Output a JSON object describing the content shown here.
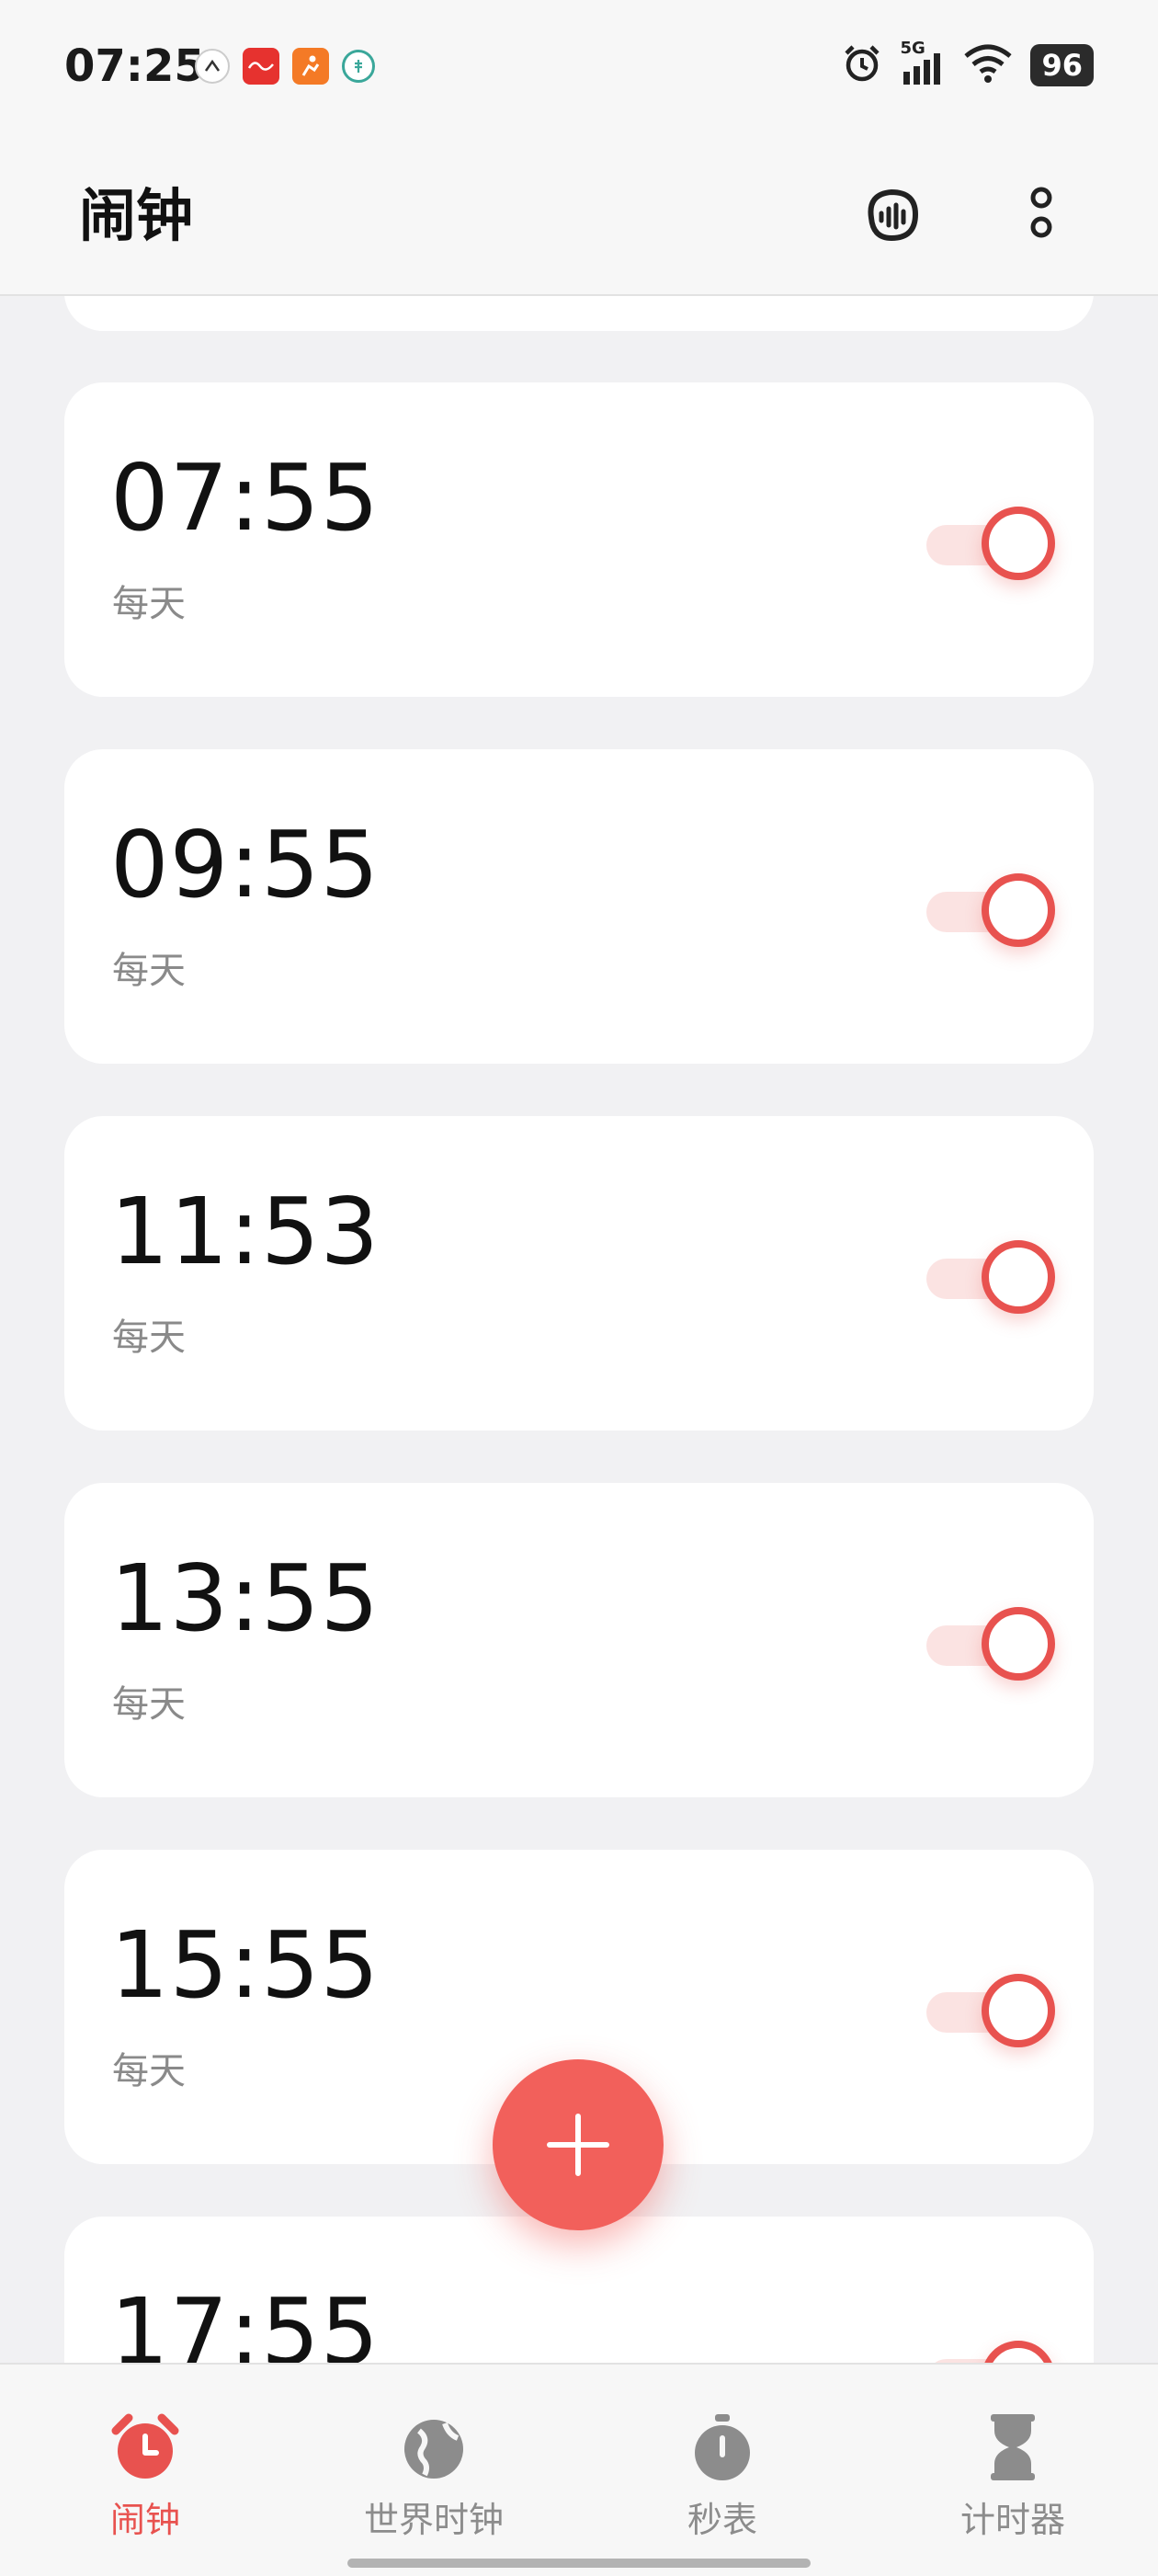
{
  "status_bar": {
    "time": "07:25",
    "battery": "96",
    "network": "5G"
  },
  "header": {
    "title": "闹钟"
  },
  "alarms": [
    {
      "time": "07:55",
      "repeat": "每天",
      "enabled": true
    },
    {
      "time": "09:55",
      "repeat": "每天",
      "enabled": true
    },
    {
      "time": "11:53",
      "repeat": "每天",
      "enabled": true
    },
    {
      "time": "13:55",
      "repeat": "每天",
      "enabled": true
    },
    {
      "time": "15:55",
      "repeat": "每天",
      "enabled": true
    },
    {
      "time": "17:55",
      "repeat": "",
      "enabled": true
    }
  ],
  "bottom_nav": [
    {
      "label": "闹钟",
      "icon": "alarm-clock-icon",
      "active": true
    },
    {
      "label": "世界时钟",
      "icon": "globe-icon",
      "active": false
    },
    {
      "label": "秒表",
      "icon": "stopwatch-icon",
      "active": false
    },
    {
      "label": "计时器",
      "icon": "hourglass-icon",
      "active": false
    }
  ],
  "colors": {
    "accent": "#e8524f",
    "fab": "#f2605b",
    "background": "#f1f1f3"
  }
}
